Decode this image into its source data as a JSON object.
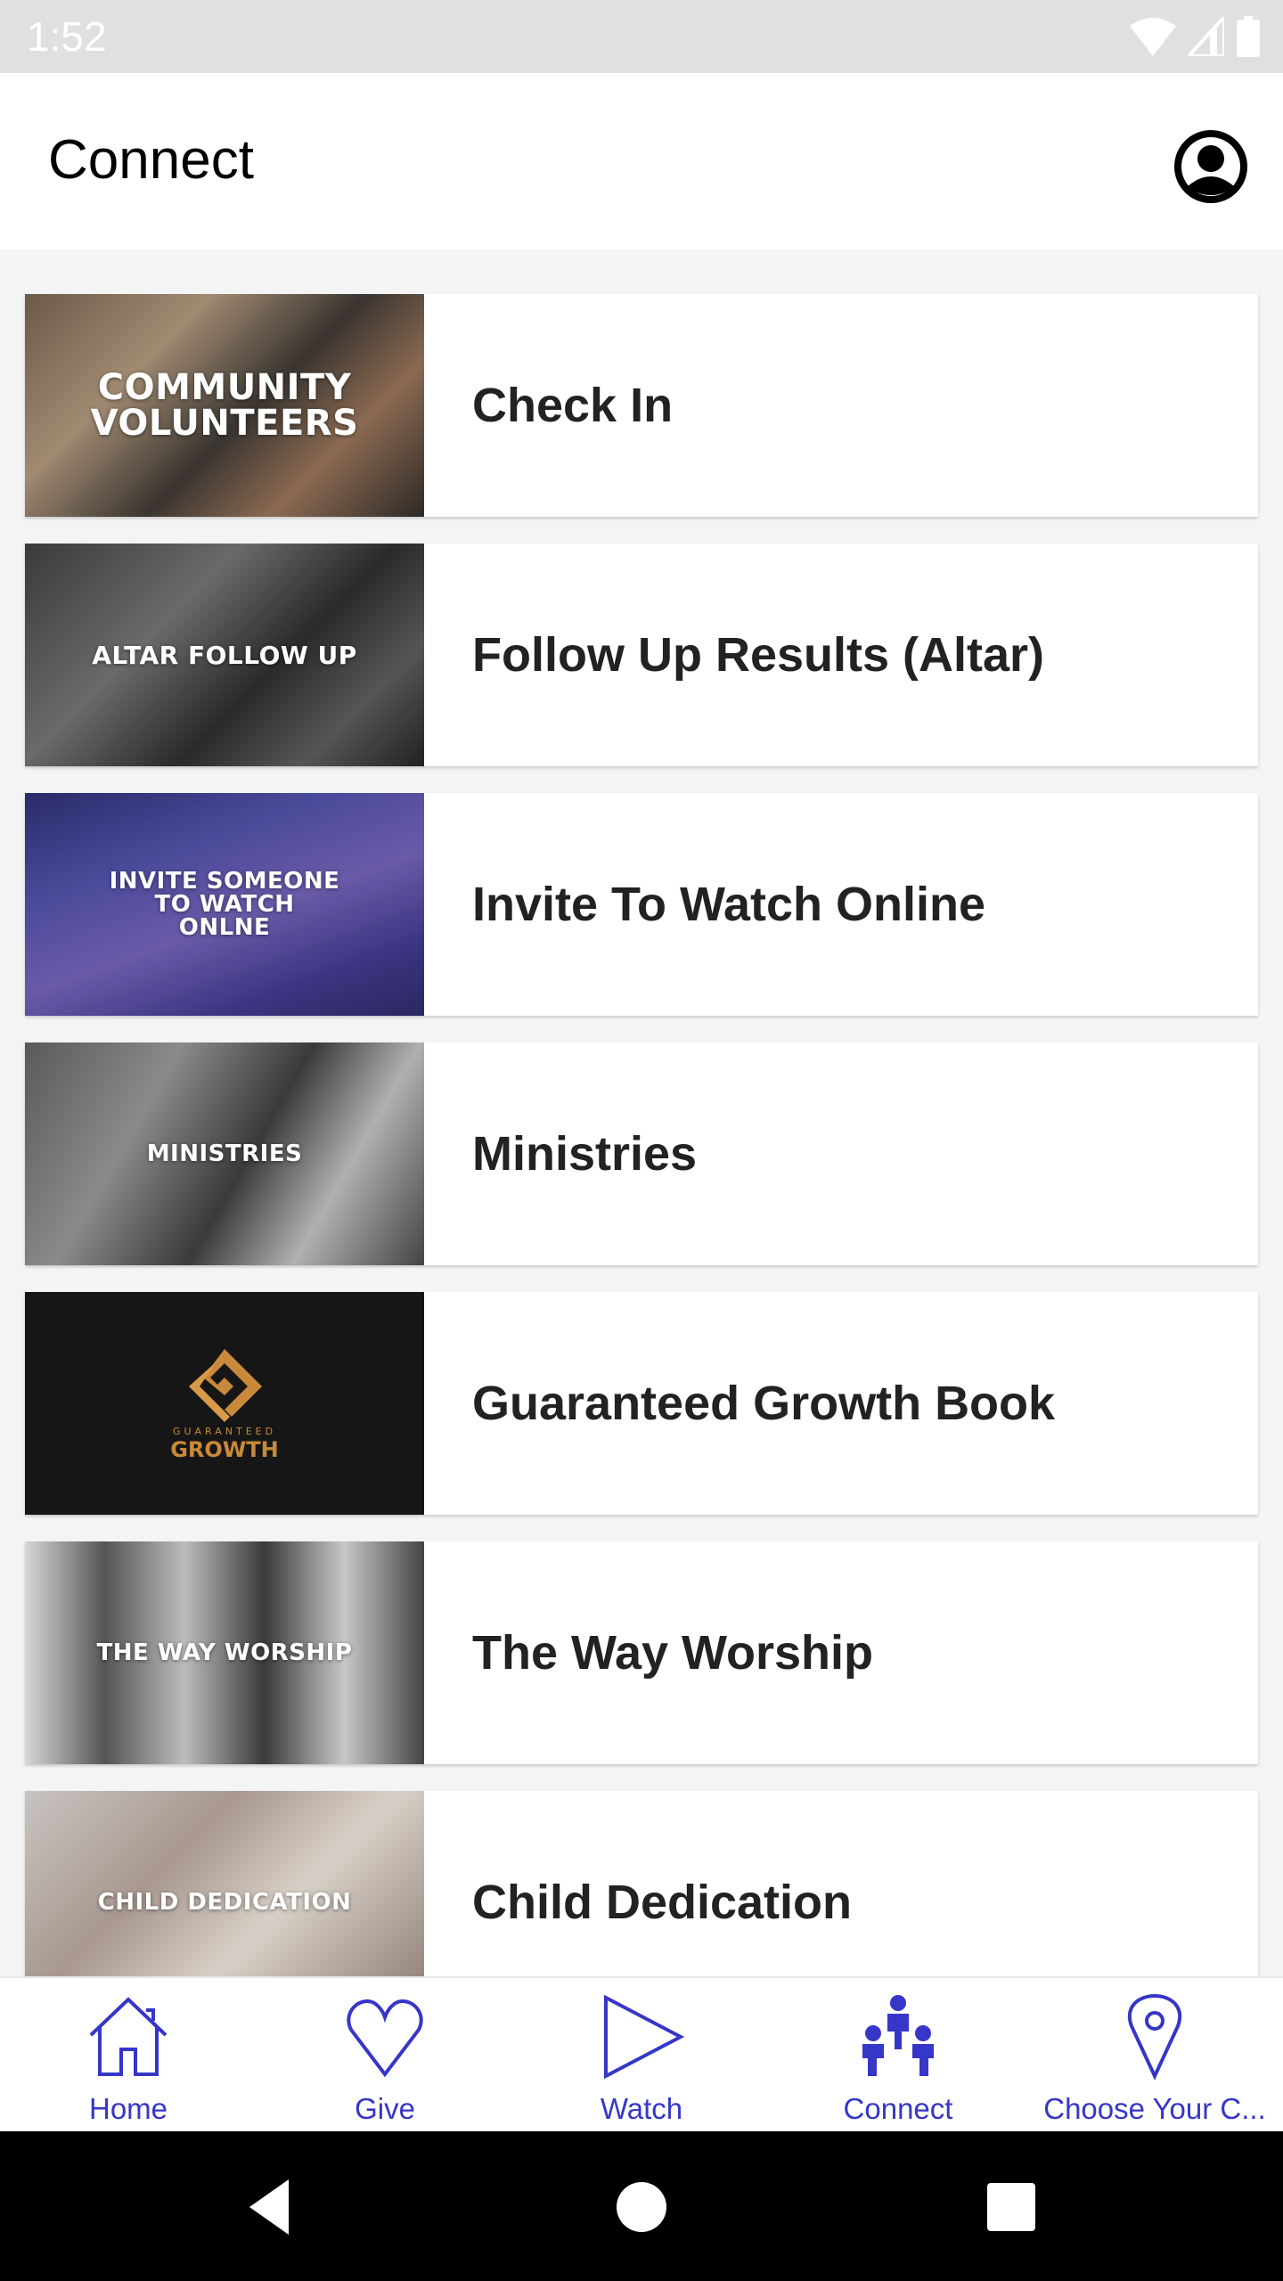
{
  "status_bar": {
    "time": "1:52",
    "icons": [
      "wifi-icon",
      "cell-signal-icon",
      "battery-icon"
    ]
  },
  "header": {
    "title": "Connect",
    "profile_icon": "account-circle-icon"
  },
  "items": [
    {
      "label": "Check In",
      "thumb_text": "COMMUNITY VOLUNTEERS",
      "thumb_style": "volunteers"
    },
    {
      "label": "Follow Up Results (Altar)",
      "thumb_text": "ALTAR FOLLOW UP",
      "thumb_style": "altar"
    },
    {
      "label": "Invite To Watch Online",
      "thumb_text": "INVITE SOMEONE TO WATCH ONLNE",
      "thumb_style": "invite"
    },
    {
      "label": "Ministries",
      "thumb_text": "MINISTRIES",
      "thumb_style": "ministries"
    },
    {
      "label": "Guaranteed Growth Book",
      "thumb_text": "GUARANTEED GROWTH",
      "thumb_style": "growth"
    },
    {
      "label": "The Way Worship",
      "thumb_text": "THE WAY WORSHIP",
      "thumb_style": "worship"
    },
    {
      "label": "Child Dedication",
      "thumb_text": "CHILD DEDICATION",
      "thumb_style": "child"
    }
  ],
  "bottom_nav": {
    "accent_color": "#3636c8",
    "items": [
      {
        "label": "Home",
        "icon": "home-icon"
      },
      {
        "label": "Give",
        "icon": "heart-icon"
      },
      {
        "label": "Watch",
        "icon": "play-icon"
      },
      {
        "label": "Connect",
        "icon": "people-icon",
        "active": true
      },
      {
        "label": "Choose Your C...",
        "icon": "location-pin-icon"
      }
    ]
  },
  "system_nav": {
    "buttons": [
      "back",
      "home",
      "recents"
    ]
  }
}
